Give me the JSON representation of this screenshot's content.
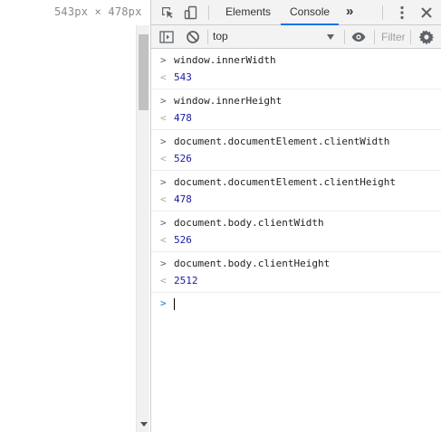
{
  "page": {
    "viewport_size_label": "543px × 478px"
  },
  "tabs": {
    "elements_label": "Elements",
    "console_label": "Console",
    "more_label": "»"
  },
  "toolbar": {
    "context_value": "top",
    "filter_placeholder": "Filter"
  },
  "console": {
    "entries": [
      {
        "command": "window.innerWidth",
        "result": "543"
      },
      {
        "command": "window.innerHeight",
        "result": "478"
      },
      {
        "command": "document.documentElement.clientWidth",
        "result": "526"
      },
      {
        "command": "document.documentElement.clientHeight",
        "result": "478"
      },
      {
        "command": "document.body.clientWidth",
        "result": "526"
      },
      {
        "command": "document.body.clientHeight",
        "result": "2512"
      }
    ]
  },
  "icons": {
    "inspect": "inspect-element-icon",
    "device": "device-toolbar-icon",
    "kebab": "kebab-menu-icon",
    "close": "close-icon",
    "sidebar": "console-sidebar-icon",
    "clear": "clear-console-icon",
    "eye": "live-expression-icon",
    "gear": "console-settings-icon"
  },
  "colors": {
    "active_tab_underline": "#1a73e8",
    "result_value": "#1a1aa6",
    "toolbar_bg": "#f3f3f3"
  }
}
